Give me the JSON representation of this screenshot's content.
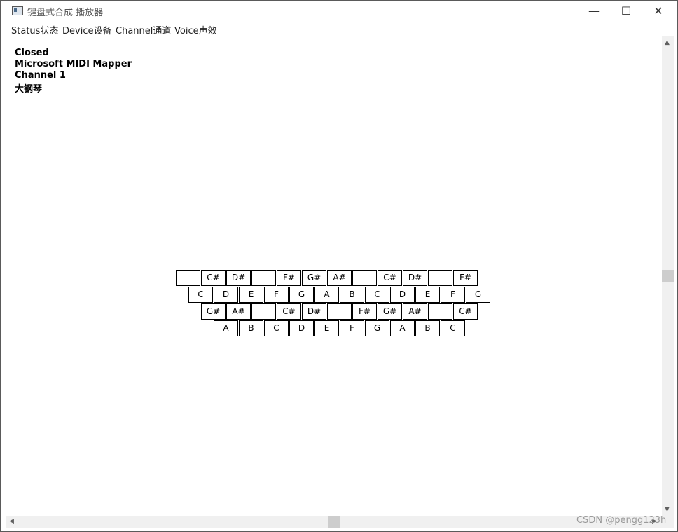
{
  "window": {
    "title": "键盘式合成 播放器",
    "minimize_glyph": "—",
    "maximize_glyph": "☐",
    "close_glyph": "✕"
  },
  "menu": [
    "Status状态",
    "Device设备",
    "Channel通道",
    "Voice声效"
  ],
  "status": {
    "state": "Closed",
    "device": "Microsoft MIDI Mapper",
    "channel": "Channel 1",
    "voice": "大钢琴"
  },
  "keyboard": {
    "rows": [
      [
        "",
        "C#",
        "D#",
        "",
        "F#",
        "G#",
        "A#",
        "",
        "C#",
        "D#",
        "",
        "F#"
      ],
      [
        "C",
        "D",
        "E",
        "F",
        "G",
        "A",
        "B",
        "C",
        "D",
        "E",
        "F",
        "G"
      ],
      [
        "G#",
        "A#",
        "",
        "C#",
        "D#",
        "",
        "F#",
        "G#",
        "A#",
        "",
        "C#"
      ],
      [
        "A",
        "B",
        "C",
        "D",
        "E",
        "F",
        "G",
        "A",
        "B",
        "C"
      ]
    ]
  },
  "watermark": "CSDN @pengg123h"
}
